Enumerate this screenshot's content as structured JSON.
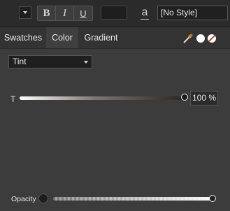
{
  "toolbar": {
    "bold_label": "B",
    "italic_label": "I",
    "underline_label": "U",
    "char_style_icon_label": "a",
    "style_select_value": "[No Style]"
  },
  "tabs": [
    {
      "label": "Swatches"
    },
    {
      "label": "Color"
    },
    {
      "label": "Gradient"
    }
  ],
  "color_panel": {
    "mode_value": "Tint",
    "tint_label": "T",
    "tint_value_text": "100 %",
    "tint_value": 1.0,
    "opacity_label": "Opacity",
    "opacity_value": 1.0,
    "current_color": "#1e1e1e"
  },
  "icons": [
    "chevron-down-icon",
    "eyedropper-icon",
    "white-swatch-icon",
    "none-swatch-icon",
    "character-style-icon"
  ]
}
